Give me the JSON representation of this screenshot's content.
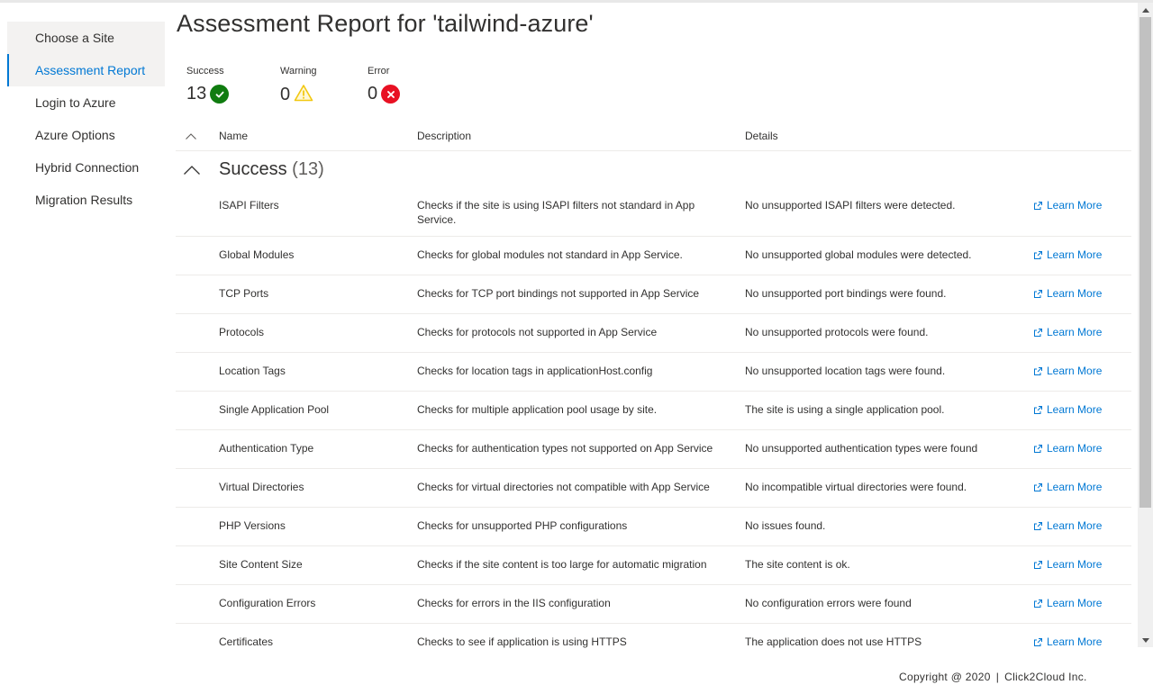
{
  "sidebar": {
    "items": [
      {
        "label": "Choose a Site"
      },
      {
        "label": "Assessment Report",
        "active": true
      },
      {
        "label": "Login to Azure"
      },
      {
        "label": "Azure Options"
      },
      {
        "label": "Hybrid Connection"
      },
      {
        "label": "Migration Results"
      }
    ]
  },
  "page": {
    "title": "Assessment Report for 'tailwind-azure'"
  },
  "summary": {
    "success": {
      "label": "Success",
      "value": "13",
      "icon": "check-circle-icon",
      "color": "#107c10"
    },
    "warning": {
      "label": "Warning",
      "value": "0",
      "icon": "warning-icon",
      "color": "#f2c811"
    },
    "error": {
      "label": "Error",
      "value": "0",
      "icon": "error-circle-icon",
      "color": "#e81123"
    }
  },
  "list": {
    "columns": {
      "name": "Name",
      "description": "Description",
      "details": "Details"
    },
    "group": {
      "title": "Success",
      "count": "(13)"
    },
    "link_label": "Learn More",
    "link_color": "#0078d4",
    "rows": [
      {
        "name": "ISAPI Filters",
        "description": "Checks if the site is using ISAPI filters not standard in App Service.",
        "details": "No unsupported ISAPI filters were detected."
      },
      {
        "name": "Global Modules",
        "description": "Checks for global modules not standard in App Service.",
        "details": "No unsupported global modules were detected."
      },
      {
        "name": "TCP Ports",
        "description": "Checks for TCP port bindings not supported in App Service",
        "details": "No unsupported port bindings were found."
      },
      {
        "name": "Protocols",
        "description": "Checks for protocols not supported in App Service",
        "details": "No unsupported protocols were found."
      },
      {
        "name": "Location Tags",
        "description": "Checks for location tags in applicationHost.config",
        "details": "No unsupported location tags were found."
      },
      {
        "name": "Single Application Pool",
        "description": "Checks for multiple application pool usage by site.",
        "details": "The site is using a single application pool."
      },
      {
        "name": "Authentication Type",
        "description": "Checks for authentication types not supported on App Service",
        "details": "No unsupported authentication types were found"
      },
      {
        "name": "Virtual Directories",
        "description": "Checks for virtual directories not compatible with App Service",
        "details": "No incompatible virtual directories were found."
      },
      {
        "name": "PHP Versions",
        "description": "Checks for unsupported PHP configurations",
        "details": "No issues found."
      },
      {
        "name": "Site Content Size",
        "description": "Checks if the site content is too large for automatic migration",
        "details": "The site content is ok."
      },
      {
        "name": "Configuration Errors",
        "description": "Checks for errors in the IIS configuration",
        "details": "No configuration errors were found"
      },
      {
        "name": "Certificates",
        "description": "Checks to see if application is using HTTPS",
        "details": "The application does not use HTTPS"
      }
    ]
  },
  "footer": {
    "copyright": "Copyright @ 2020",
    "separator": "|",
    "company": "Click2Cloud Inc."
  }
}
